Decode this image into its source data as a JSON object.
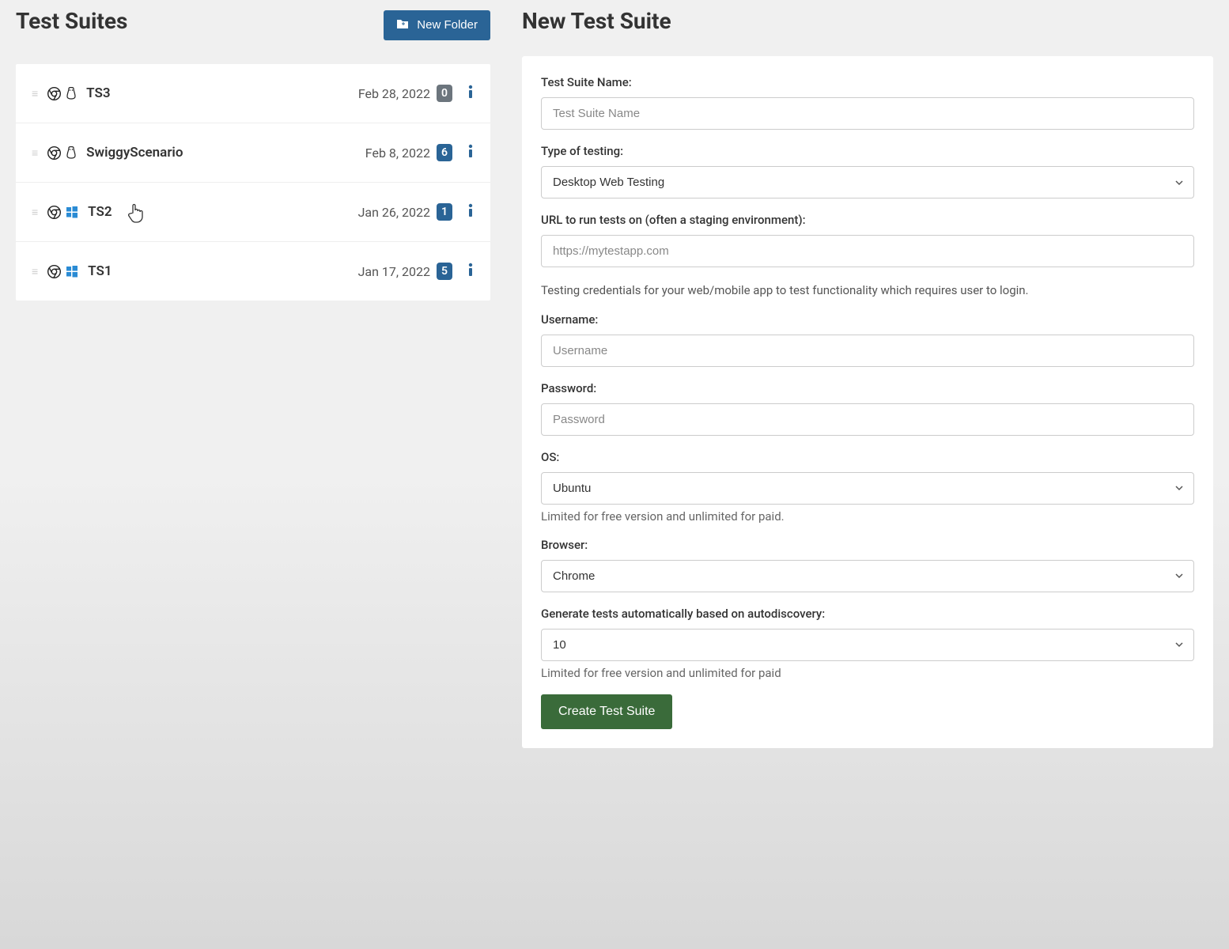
{
  "left": {
    "title": "Test Suites",
    "new_folder_label": "New Folder",
    "suites": [
      {
        "name": "TS3",
        "date": "Feb 28, 2022",
        "count": "0",
        "badge_color": "gray",
        "os": "linux"
      },
      {
        "name": "SwiggyScenario",
        "date": "Feb 8, 2022",
        "count": "6",
        "badge_color": "blue",
        "os": "linux"
      },
      {
        "name": "TS2",
        "date": "Jan 26, 2022",
        "count": "1",
        "badge_color": "blue",
        "os": "windows"
      },
      {
        "name": "TS1",
        "date": "Jan 17, 2022",
        "count": "5",
        "badge_color": "blue",
        "os": "windows"
      }
    ]
  },
  "right": {
    "title": "New Test Suite",
    "name_label": "Test Suite Name:",
    "name_placeholder": "Test Suite Name",
    "type_label": "Type of testing:",
    "type_value": "Desktop Web Testing",
    "url_label": "URL to run tests on (often a staging environment):",
    "url_placeholder": "https://mytestapp.com",
    "creds_text": "Testing credentials for your web/mobile app to test functionality which requires user to login.",
    "username_label": "Username:",
    "username_placeholder": "Username",
    "password_label": "Password:",
    "password_placeholder": "Password",
    "os_label": "OS:",
    "os_value": "Ubuntu",
    "os_hint": "Limited for free version and unlimited for paid.",
    "browser_label": "Browser:",
    "browser_value": "Chrome",
    "auto_label": "Generate tests automatically based on autodiscovery:",
    "auto_value": "10",
    "auto_hint": "Limited for free version and unlimited for paid",
    "create_label": "Create Test Suite"
  }
}
